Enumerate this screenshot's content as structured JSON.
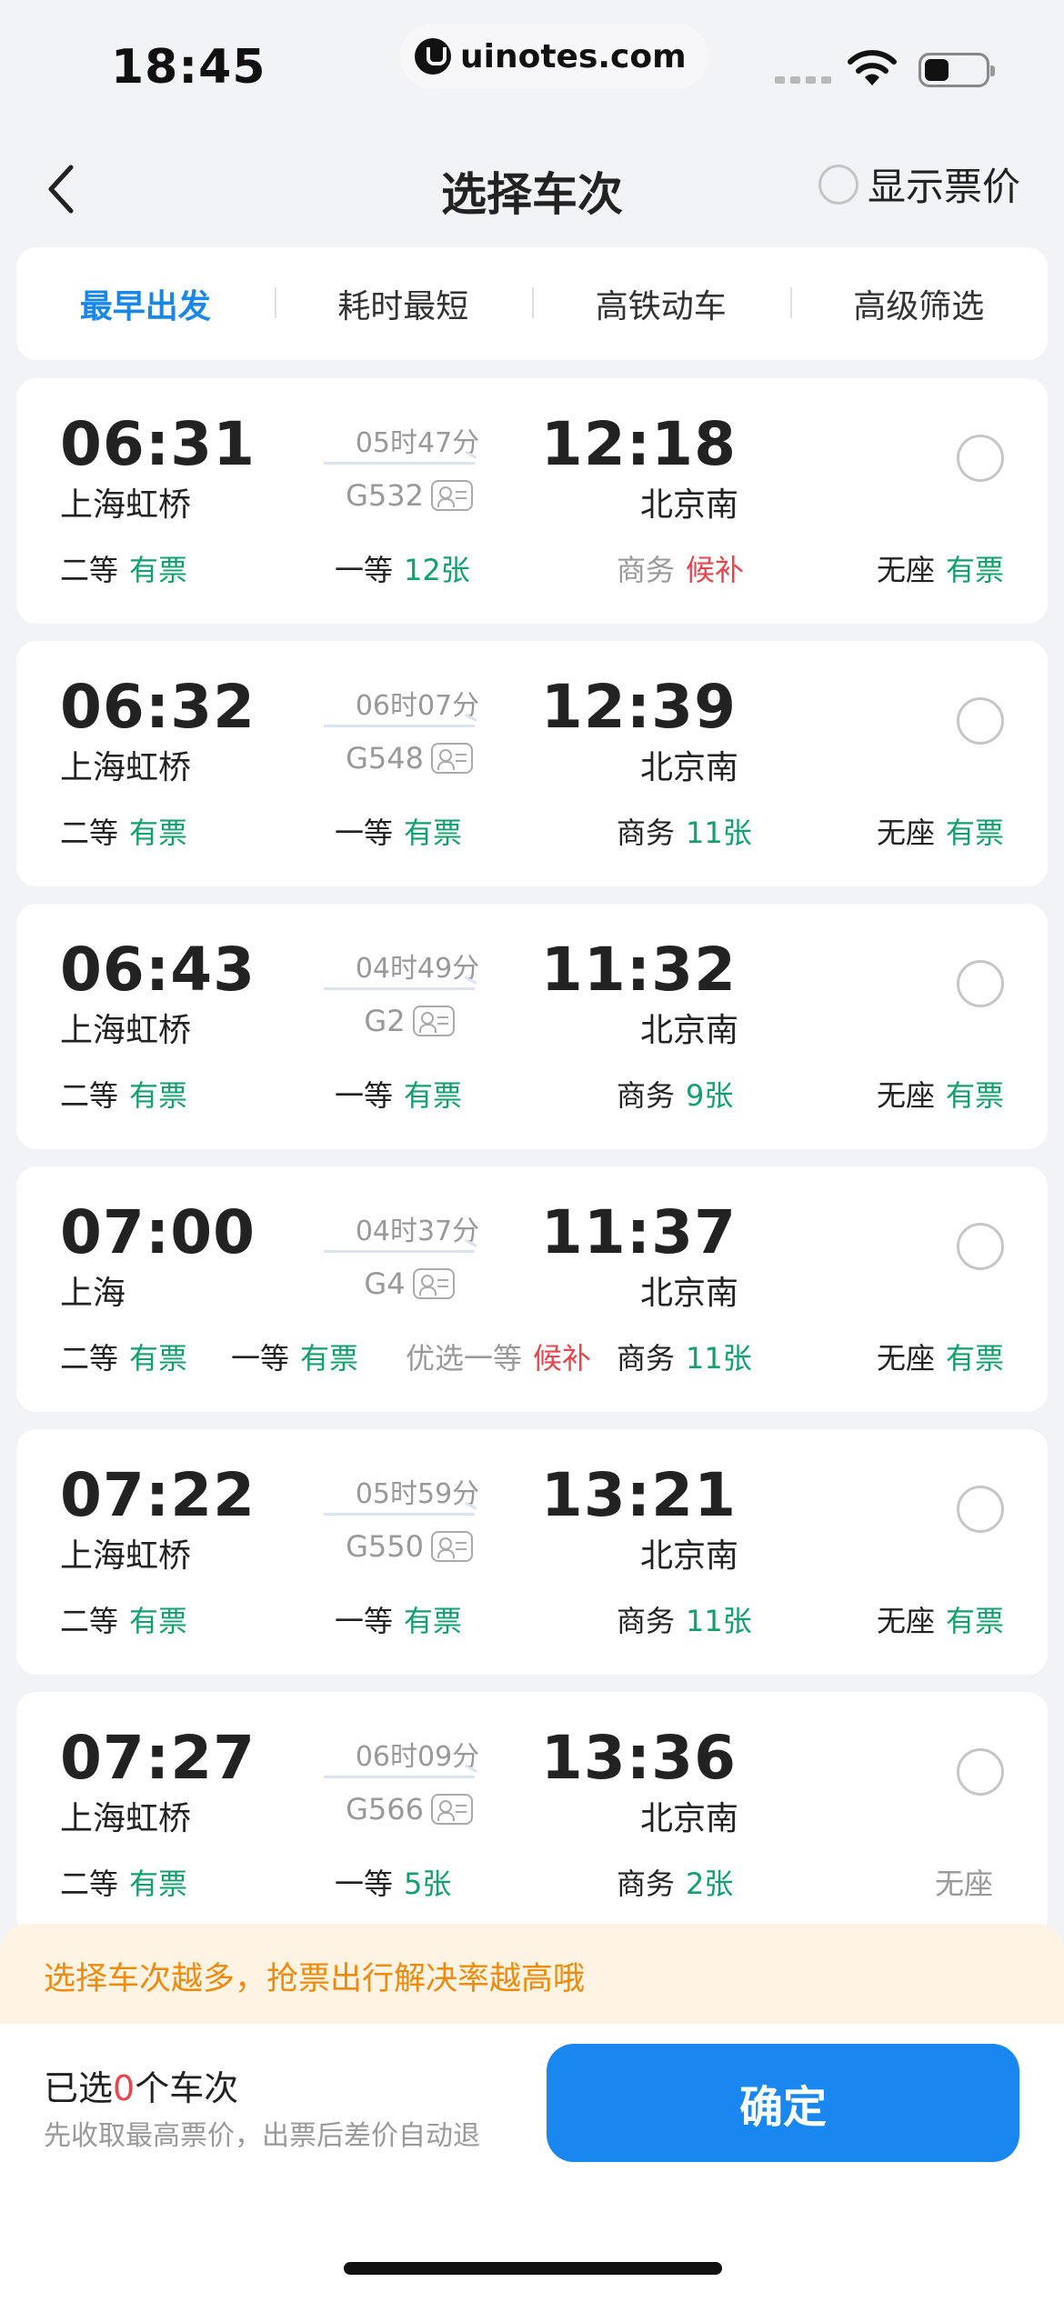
{
  "status": {
    "time": "18:45",
    "url": "uinotes.com"
  },
  "nav": {
    "title": "选择车次",
    "price_label": "显示票价"
  },
  "tabs": [
    "最早出发",
    "耗时最短",
    "高铁动车",
    "高级筛选"
  ],
  "trains": [
    {
      "dep_time": "06:31",
      "dep_station": "上海虹桥",
      "duration": "05时47分",
      "train_no": "G532",
      "arr_time": "12:18",
      "arr_station": "北京南",
      "seats": [
        {
          "name": "二等",
          "status": "有票",
          "color": "green"
        },
        {
          "name": "一等",
          "status": "12张",
          "color": "green"
        },
        {
          "name": "商务",
          "status": "候补",
          "color": "red",
          "dim": true
        },
        {
          "name": "无座",
          "status": "有票",
          "color": "green"
        }
      ]
    },
    {
      "dep_time": "06:32",
      "dep_station": "上海虹桥",
      "duration": "06时07分",
      "train_no": "G548",
      "arr_time": "12:39",
      "arr_station": "北京南",
      "seats": [
        {
          "name": "二等",
          "status": "有票",
          "color": "green"
        },
        {
          "name": "一等",
          "status": "有票",
          "color": "green"
        },
        {
          "name": "商务",
          "status": "11张",
          "color": "green"
        },
        {
          "name": "无座",
          "status": "有票",
          "color": "green"
        }
      ]
    },
    {
      "dep_time": "06:43",
      "dep_station": "上海虹桥",
      "duration": "04时49分",
      "train_no": "G2",
      "arr_time": "11:32",
      "arr_station": "北京南",
      "seats": [
        {
          "name": "二等",
          "status": "有票",
          "color": "green"
        },
        {
          "name": "一等",
          "status": "有票",
          "color": "green"
        },
        {
          "name": "商务",
          "status": "9张",
          "color": "green"
        },
        {
          "name": "无座",
          "status": "有票",
          "color": "green"
        }
      ]
    },
    {
      "dep_time": "07:00",
      "dep_station": "上海",
      "duration": "04时37分",
      "train_no": "G4",
      "arr_time": "11:37",
      "arr_station": "北京南",
      "seats": [
        {
          "name": "二等",
          "status": "有票",
          "color": "green"
        },
        {
          "name": "一等",
          "status": "有票",
          "color": "green"
        },
        {
          "name": "优选一等",
          "status": "候补",
          "color": "red",
          "dim": true
        },
        {
          "name": "商务",
          "status": "11张",
          "color": "green"
        },
        {
          "name": "无座",
          "status": "有票",
          "color": "green"
        }
      ]
    },
    {
      "dep_time": "07:22",
      "dep_station": "上海虹桥",
      "duration": "05时59分",
      "train_no": "G550",
      "arr_time": "13:21",
      "arr_station": "北京南",
      "seats": [
        {
          "name": "二等",
          "status": "有票",
          "color": "green"
        },
        {
          "name": "一等",
          "status": "有票",
          "color": "green"
        },
        {
          "name": "商务",
          "status": "11张",
          "color": "green"
        },
        {
          "name": "无座",
          "status": "有票",
          "color": "green"
        }
      ]
    },
    {
      "dep_time": "07:27",
      "dep_station": "上海虹桥",
      "duration": "06时09分",
      "train_no": "G566",
      "arr_time": "13:36",
      "arr_station": "北京南",
      "seats": [
        {
          "name": "二等",
          "status": "有票",
          "color": "green"
        },
        {
          "name": "一等",
          "status": "5张",
          "color": "green"
        },
        {
          "name": "商务",
          "status": "2张",
          "color": "green"
        },
        {
          "name": "无座",
          "status": "",
          "color": "gray",
          "dim": true
        }
      ]
    }
  ],
  "tip": "选择车次越多，抢票出行解决率越高哦",
  "bottom": {
    "selected_prefix": "已选",
    "selected_count": "0",
    "selected_suffix": "个车次",
    "note": "先收取最高票价，出票后差价自动退",
    "confirm": "确定"
  },
  "colors": {
    "accent": "#1a86f0",
    "available": "#14a06c",
    "waitlist": "#e8454f",
    "tip": "#f08a0c"
  }
}
